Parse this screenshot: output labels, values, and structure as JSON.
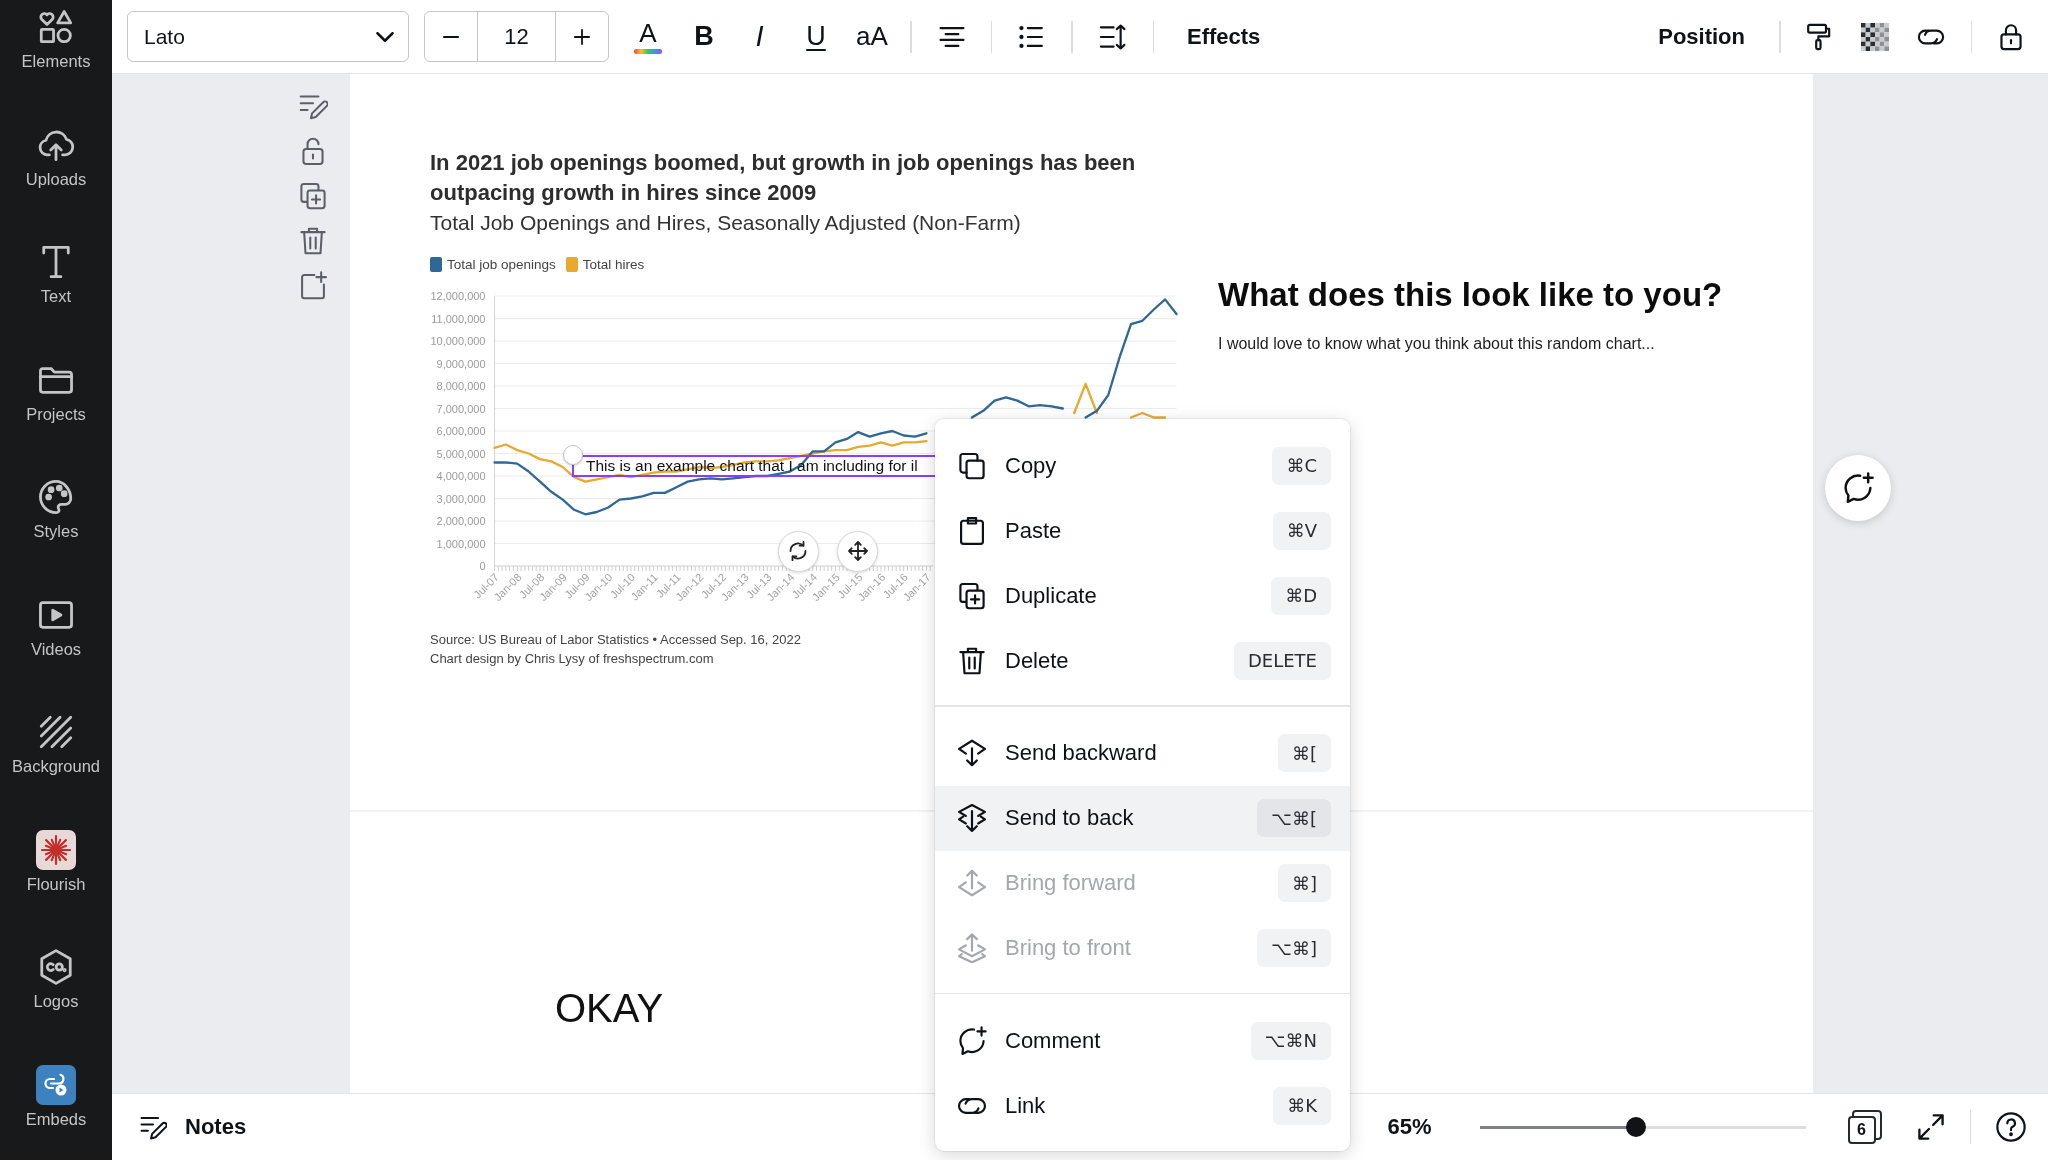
{
  "sidebar": {
    "items": [
      {
        "label": "Elements",
        "selected": false
      },
      {
        "label": "Uploads",
        "selected": false
      },
      {
        "label": "Text",
        "selected": false
      },
      {
        "label": "Projects",
        "selected": false
      },
      {
        "label": "Styles",
        "selected": false
      },
      {
        "label": "Videos",
        "selected": false
      },
      {
        "label": "Background",
        "selected": false
      },
      {
        "label": "Flourish",
        "selected": false
      },
      {
        "label": "Logos",
        "selected": false
      },
      {
        "label": "Embeds",
        "selected": false
      }
    ]
  },
  "toolbar": {
    "font": {
      "value": "Lato"
    },
    "font_size": {
      "value": "12"
    },
    "text_color": {
      "label": "A"
    },
    "format_buttons": [
      {
        "kind": "bold",
        "label": "B"
      },
      {
        "kind": "italic",
        "label": "I"
      },
      {
        "kind": "underline",
        "label": "U"
      },
      {
        "kind": "case",
        "label": "aA"
      }
    ],
    "effects": {
      "label": "Effects"
    },
    "position": {
      "label": "Position"
    }
  },
  "page_1": {
    "chart": {
      "chart_data": {
        "type": "line",
        "title": "In 2021 job openings boomed, but growth in job openings has been outpacing growth in hires since 2009",
        "categories": [
          "Jul-07",
          null,
          "Jan-08",
          null,
          "Jul-08",
          null,
          "Jan-09",
          null,
          "Jul-09",
          null,
          "Jan-10",
          null,
          "Jul-10",
          null,
          "Jan-11",
          null,
          "Jul-11",
          null,
          "Jan-12",
          null,
          "Jul-12",
          null,
          "Jan-13",
          null,
          "Jul-13",
          null,
          "Jan-14",
          null,
          "Jul-14",
          null,
          "Jan-15",
          null,
          "Jul-15",
          null,
          "Jan-16",
          null,
          "Jul-16",
          null,
          "Jan-17",
          null,
          null,
          null,
          null,
          null,
          null,
          null,
          null,
          null,
          null,
          null,
          null,
          null,
          null,
          null,
          null,
          null,
          null,
          null,
          null,
          null,
          null
        ],
        "series": [
          {
            "name": "Total job openings",
            "color": "#2f6796",
            "values": [
              4600000,
              4600000,
              4550000,
              4200000,
              3750000,
              3300000,
              2950000,
              2500000,
              2300000,
              2400000,
              2600000,
              2950000,
              3000000,
              3100000,
              3250000,
              3250000,
              3500000,
              3750000,
              3850000,
              3900000,
              3850000,
              3900000,
              3950000,
              4000000,
              4000000,
              4100000,
              4200000,
              4500000,
              5100000,
              5100000,
              5500000,
              5650000,
              5950000,
              5750000,
              5900000,
              6000000,
              5800000,
              5750000,
              5900000,
              null,
              null,
              null,
              6600000,
              6900000,
              7350000,
              7500000,
              7350000,
              7100000,
              7150000,
              7100000,
              7000000,
              null,
              6600000,
              6900000,
              7600000,
              9300000,
              10750000,
              10900000,
              11400000,
              11850000,
              11200000
            ]
          },
          {
            "name": "Total hires",
            "color": "#e6aa2f",
            "values": [
              5250000,
              5400000,
              5150000,
              5000000,
              4750000,
              4650000,
              4400000,
              3950000,
              3750000,
              3850000,
              3950000,
              4050000,
              3950000,
              4050000,
              4150000,
              4200000,
              4200000,
              4300000,
              4400000,
              4350000,
              4400000,
              4500000,
              4600000,
              4650000,
              4650000,
              4700000,
              4800000,
              4900000,
              5000000,
              5100000,
              5150000,
              5150000,
              5300000,
              5350000,
              5500000,
              5350000,
              5500000,
              5500000,
              5550000,
              null,
              null,
              null,
              null,
              null,
              null,
              null,
              null,
              null,
              null,
              null,
              null,
              6800000,
              8100000,
              6800000,
              null,
              null,
              6600000,
              6800000,
              6600000,
              6600000,
              null
            ]
          }
        ],
        "ylim": [
          0,
          12000000
        ],
        "grid": true,
        "yticks": [
          {
            "value": 0,
            "label": "0"
          },
          {
            "value": 1000000,
            "label": "1,000,000"
          },
          {
            "value": 2000000,
            "label": "2,000,000"
          },
          {
            "value": 3000000,
            "label": "3,000,000"
          },
          {
            "value": 4000000,
            "label": "4,000,000"
          },
          {
            "value": 5000000,
            "label": "5,000,000"
          },
          {
            "value": 6000000,
            "label": "6,000,000"
          },
          {
            "value": 7000000,
            "label": "7,000,000"
          },
          {
            "value": 8000000,
            "label": "8,000,000"
          },
          {
            "value": 9000000,
            "label": "9,000,000"
          },
          {
            "value": 10000000,
            "label": "10,000,000"
          },
          {
            "value": 11000000,
            "label": "11,000,000"
          },
          {
            "value": 12000000,
            "label": "12,000,000"
          }
        ]
      },
      "subtitle": "Total Job Openings and Hires, Seasonally Adjusted (Non-Farm)",
      "source": "Source: US Bureau of Labor Statistics • Accessed Sep. 16, 2022",
      "credit": "Chart design by Chris Lysy of freshspectrum.com",
      "text_box": {
        "text": "This is an example chart that I am including for il"
      }
    },
    "heading": "What does this look like to you?",
    "body": "I would love to know what you think about this random chart..."
  },
  "page_2": {
    "text": "OKAY"
  },
  "context_menu": {
    "sections": [
      {
        "items": [
          {
            "label": "Copy",
            "shortcut": "⌘C",
            "disabled": false,
            "selected": false
          },
          {
            "label": "Paste",
            "shortcut": "⌘V",
            "disabled": false,
            "selected": false
          },
          {
            "label": "Duplicate",
            "shortcut": "⌘D",
            "disabled": false,
            "selected": false
          },
          {
            "label": "Delete",
            "shortcut": "DELETE",
            "disabled": false,
            "selected": false
          }
        ]
      },
      {
        "items": [
          {
            "label": "Send backward",
            "shortcut": "⌘[",
            "disabled": false,
            "selected": false
          },
          {
            "label": "Send to back",
            "shortcut": "⌥⌘[",
            "disabled": false,
            "selected": true
          },
          {
            "label": "Bring forward",
            "shortcut": "⌘]",
            "disabled": true,
            "selected": false
          },
          {
            "label": "Bring to front",
            "shortcut": "⌥⌘]",
            "disabled": true,
            "selected": false
          }
        ]
      },
      {
        "items": [
          {
            "label": "Comment",
            "shortcut": "⌥⌘N",
            "disabled": false,
            "selected": false
          },
          {
            "label": "Link",
            "shortcut": "⌘K",
            "disabled": false,
            "selected": false
          }
        ]
      }
    ]
  },
  "bottom_bar": {
    "notes": {
      "label": "Notes"
    },
    "zoom": {
      "value": "65%",
      "level": 0.48
    },
    "page_count": "6"
  }
}
